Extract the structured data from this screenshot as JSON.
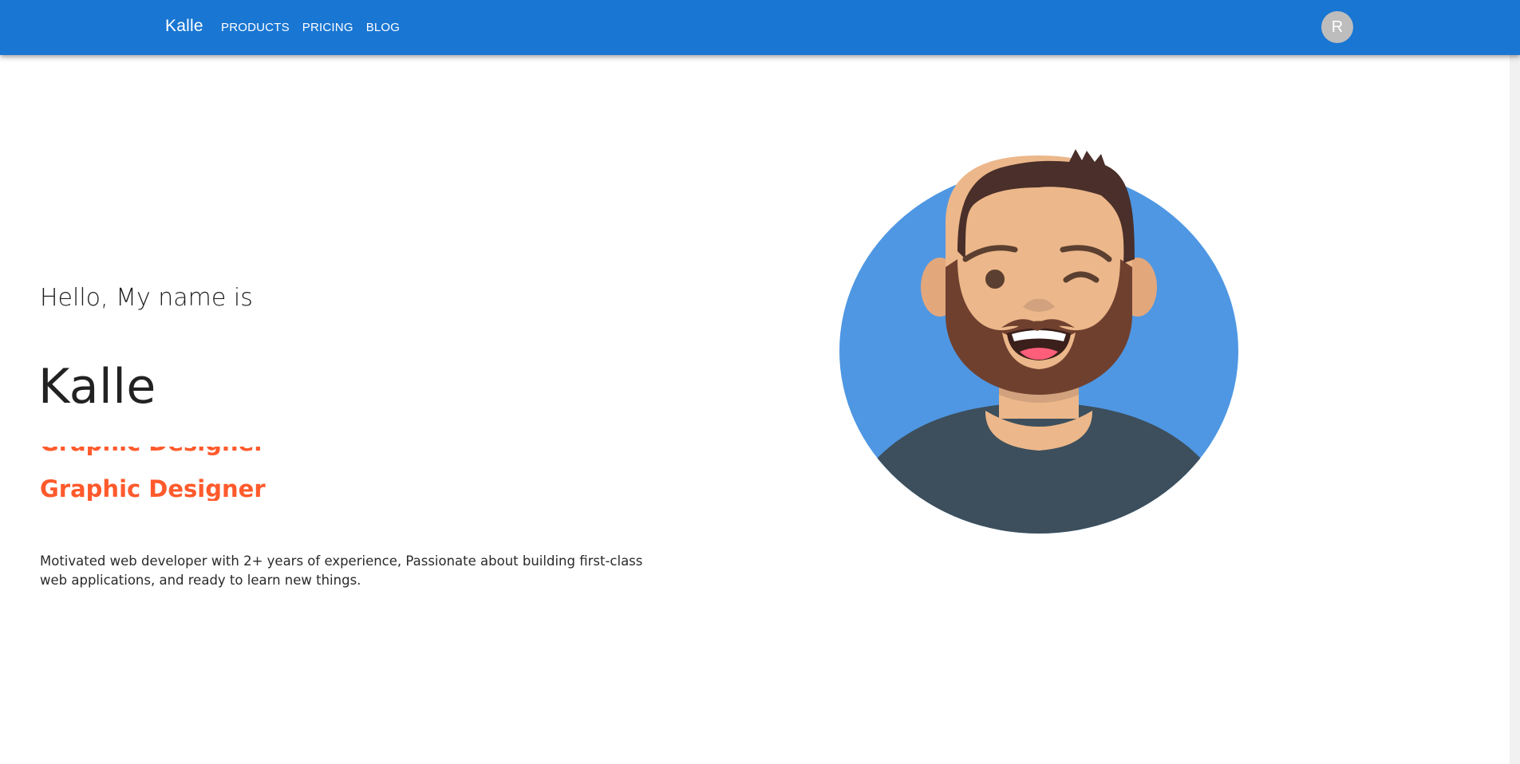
{
  "header": {
    "brand": "Kalle",
    "nav": [
      {
        "label": "PRODUCTS"
      },
      {
        "label": "PRICING"
      },
      {
        "label": "BLOG"
      }
    ],
    "avatar_initial": "R"
  },
  "hero": {
    "greeting": "Hello, My name is",
    "name": "Kalle",
    "role_previous": "Graphic Designer",
    "role_current": "Graphic Designer",
    "bio": "Motivated web developer with 2+ years of experience, Passionate about building first-class web applications, and ready to learn new things."
  },
  "colors": {
    "appbar": "#1976d2",
    "accent": "#ff5a2c",
    "avatar_bg": "#bdbdbd",
    "illustration_circle": "#4f97e3",
    "shirt": "#3d4f5c",
    "skin": "#ecb78a",
    "hair": "#4a2f2a",
    "beard": "#70402f"
  },
  "icons": {
    "illustration": "winking-bearded-man-avatar"
  }
}
